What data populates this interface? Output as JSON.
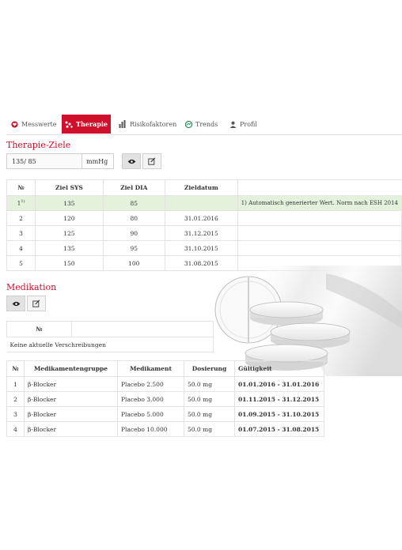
{
  "tabs": [
    {
      "label": "Messwerte",
      "icon": "heart-icon",
      "active": false
    },
    {
      "label": "Therapie",
      "icon": "network-icon",
      "active": true
    },
    {
      "label": "Risikofaktoren",
      "icon": "chart-icon",
      "active": false
    },
    {
      "label": "Trends",
      "icon": "trend-icon",
      "active": false
    },
    {
      "label": "Profil",
      "icon": "user-icon",
      "active": false
    }
  ],
  "therapy": {
    "title": "Therapie-Ziele",
    "input_value": "135/ 85",
    "unit": "mmHg",
    "headers": [
      "№",
      "Ziel SYS",
      "Ziel DIA",
      "Zieldatum",
      ""
    ],
    "rows": [
      {
        "nr": "1",
        "sup": "1)",
        "sys": "135",
        "dia": "85",
        "date": "",
        "note": "1) Automatisch generierter Wert. Norm nach ESH 2014"
      },
      {
        "nr": "2",
        "sys": "120",
        "dia": "80",
        "date": "31.01.2016"
      },
      {
        "nr": "3",
        "sys": "125",
        "dia": "90",
        "date": "31.12.2015"
      },
      {
        "nr": "4",
        "sys": "135",
        "dia": "95",
        "date": "31.10.2015"
      },
      {
        "nr": "5",
        "sys": "150",
        "dia": "100",
        "date": "31.08.2015"
      }
    ]
  },
  "medication": {
    "title": "Medikation",
    "current_header": "№",
    "empty_text": "Keine aktuelle Verschreibungen",
    "headers": [
      "№",
      "Medikamentengruppe",
      "Medikament",
      "Dosierung",
      "Gültigkeit"
    ],
    "rows": [
      {
        "nr": "1",
        "group": "β-Blocker",
        "drug": "Placebo 2.500",
        "dose": "50.0 mg",
        "valid": "01.01.2016 - 31.01.2016"
      },
      {
        "nr": "2",
        "group": "β-Blocker",
        "drug": "Placebo 3.000",
        "dose": "50.0 mg",
        "valid": "01.11.2015 - 31.12.2015"
      },
      {
        "nr": "3",
        "group": "β-Blocker",
        "drug": "Placebo 5.000",
        "dose": "50.0 mg",
        "valid": "01.09.2015 - 31.10.2015"
      },
      {
        "nr": "4",
        "group": "β-Blocker",
        "drug": "Placebo 10.000",
        "dose": "50.0 mg",
        "valid": "01.07.2015 - 31.08.2015"
      }
    ]
  },
  "colors": {
    "accent": "#d0102a",
    "highlight": "#e4f2dc"
  }
}
